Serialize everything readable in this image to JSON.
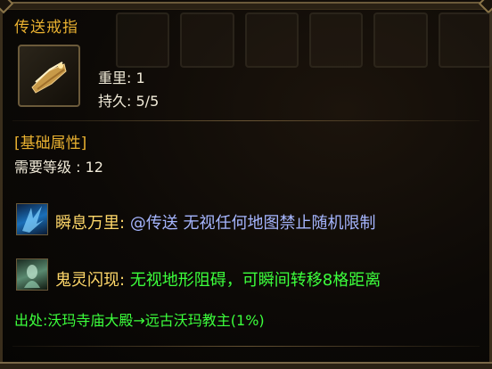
{
  "item": {
    "name": "传送戒指",
    "icon": "ring-item-icon",
    "weight_label": "重里:",
    "weight_value": "1",
    "durability_label": "持久:",
    "durability_value": "5/5"
  },
  "base_attributes": {
    "header": "[基础属性]",
    "required_level": "需要等级 : 12"
  },
  "skills": [
    {
      "icon": "teleport-skill-icon",
      "name": "瞬息万里:",
      "description": "@传送 无视任何地图禁止随机限制"
    },
    {
      "icon": "phantom-skill-icon",
      "name": "鬼灵闪现:",
      "description": "无视地形阻碍，可瞬间转移8格距离"
    }
  ],
  "source": "出处:沃玛寺庙大殿→远古沃玛教主(1%)",
  "colors": {
    "title": "#e8b030",
    "stat_text": "#f0ead8",
    "skill_name": "#ffd86a",
    "skill1_desc": "#a6b6ff",
    "green_text": "#3cff3c"
  }
}
